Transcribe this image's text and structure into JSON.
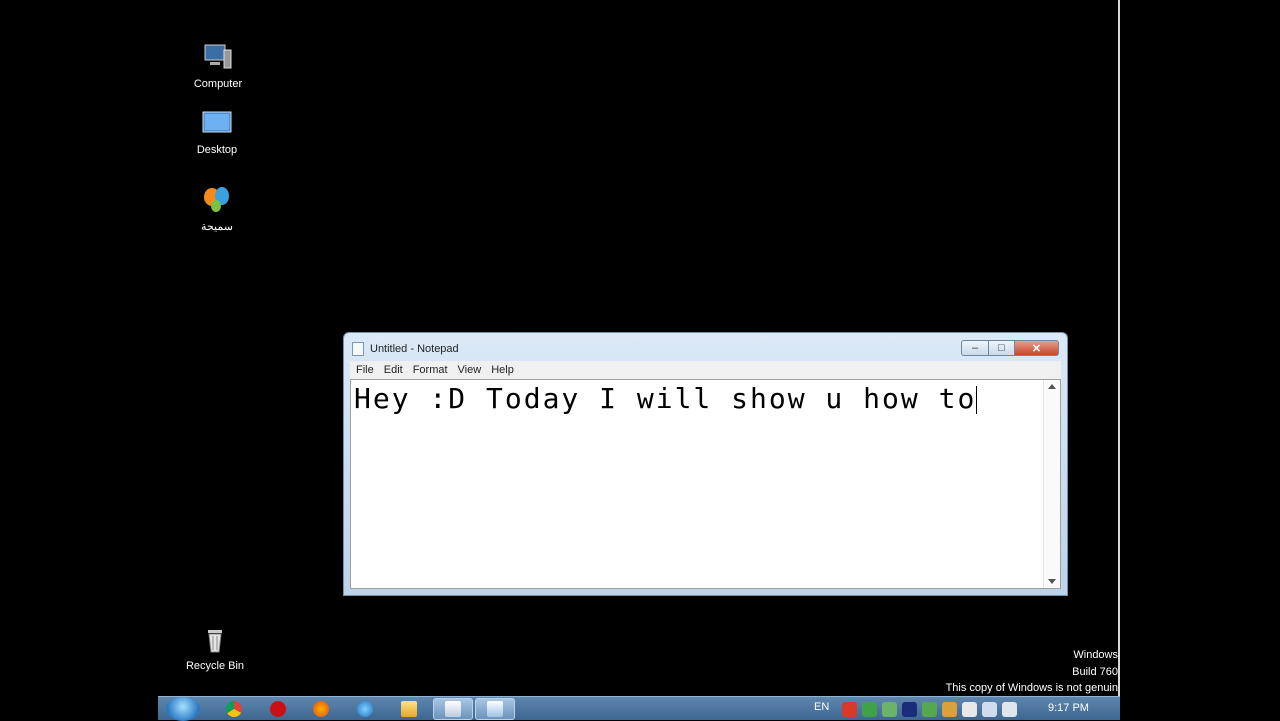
{
  "desktop_icons": [
    {
      "label": "Computer",
      "icon": "computer-icon"
    },
    {
      "label": "Desktop",
      "icon": "desktop-folder-icon"
    },
    {
      "label": "سميحة",
      "icon": "msn-butterfly-icon"
    },
    {
      "label": "Recycle Bin",
      "icon": "recycle-bin-icon"
    }
  ],
  "watermark": {
    "line1": "Windows",
    "line2": "Build 760",
    "line3": "This copy of Windows is not genuin"
  },
  "notepad": {
    "title": "Untitled - Notepad",
    "menu": [
      "File",
      "Edit",
      "Format",
      "View",
      "Help"
    ],
    "content": "Hey :D Today I will show u how to",
    "close_glyph": "✕",
    "maximize_glyph": "□",
    "minimize_glyph": "–"
  },
  "taskbar": {
    "language": "EN",
    "clock": "9:17 PM",
    "pinned": [
      "chrome-icon",
      "opera-icon",
      "firefox-icon",
      "internet-explorer-icon",
      "explorer-icon",
      "notepad-icon",
      "notepad-active-icon"
    ],
    "tray": [
      "tray-app-1-icon",
      "tray-app-2-icon",
      "tray-app-3-icon",
      "tray-app-4-icon",
      "tray-app-5-icon",
      "tray-app-6-icon",
      "flag-icon",
      "network-icon",
      "volume-icon"
    ]
  },
  "colors": {
    "desktop_bg": "#000000",
    "taskbar": "#4a739c",
    "close_button": "#c7452b"
  }
}
